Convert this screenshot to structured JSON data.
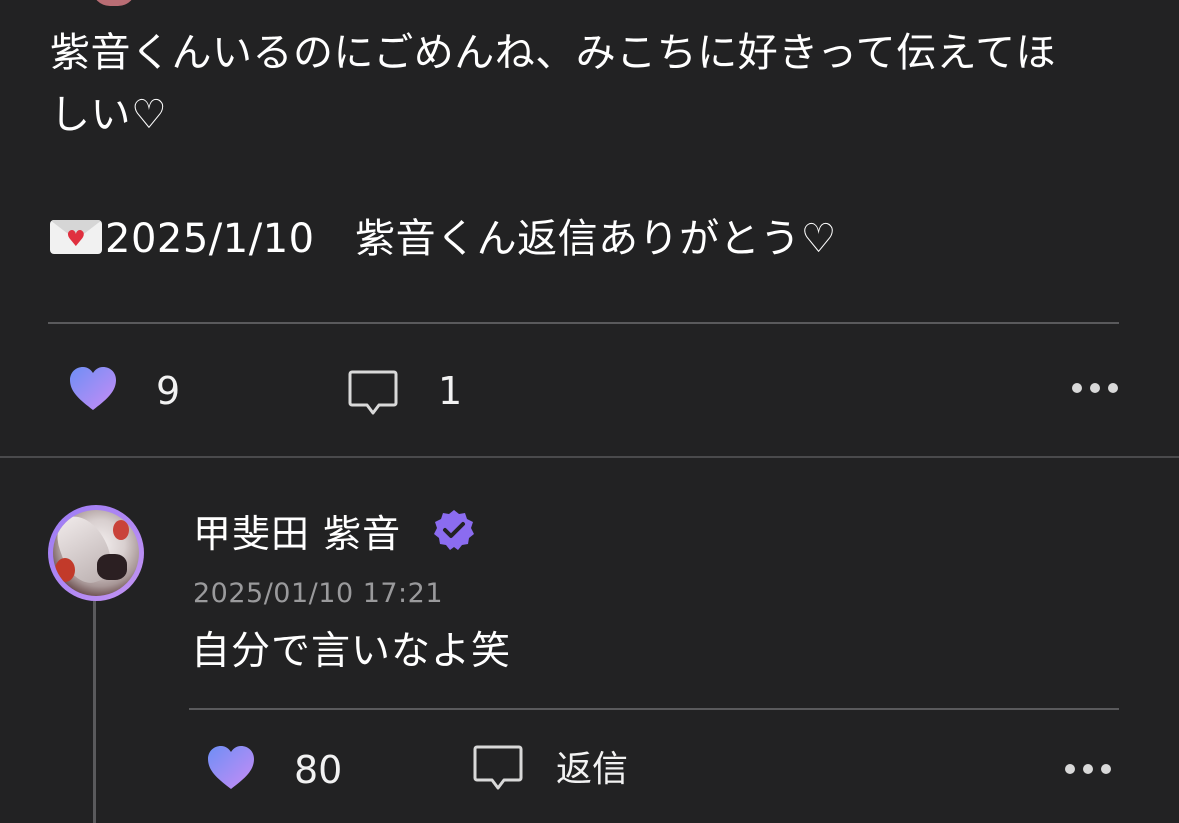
{
  "post": {
    "body_line1": "紫音くんいるのにごめんね、みこちに好きって伝えてほ",
    "body_line2": "しい♡",
    "note_icon": "love-letter-icon",
    "note_text": "2025/1/10　紫音くん返信ありがとう♡"
  },
  "post_actions": {
    "like_icon": "heart-icon",
    "like_count": "9",
    "comment_icon": "speech-bubble-icon",
    "comment_count": "1",
    "more_icon": "more-icon"
  },
  "reply": {
    "author_name": "甲斐田 紫音",
    "verified_icon": "verified-badge-icon",
    "timestamp": "2025/01/10 17:21",
    "text": "自分で言いなよ笑"
  },
  "reply_actions": {
    "like_icon": "heart-icon",
    "like_count": "80",
    "reply_icon": "speech-bubble-icon",
    "reply_label": "返信",
    "more_icon": "more-icon"
  },
  "colors": {
    "background": "#222223",
    "heart_gradient_start": "#6f8ff5",
    "heart_gradient_end": "#c88cf5",
    "verified": "#8b6cf0",
    "divider": "#5a5a5c",
    "muted_text": "#9a9a9c"
  }
}
